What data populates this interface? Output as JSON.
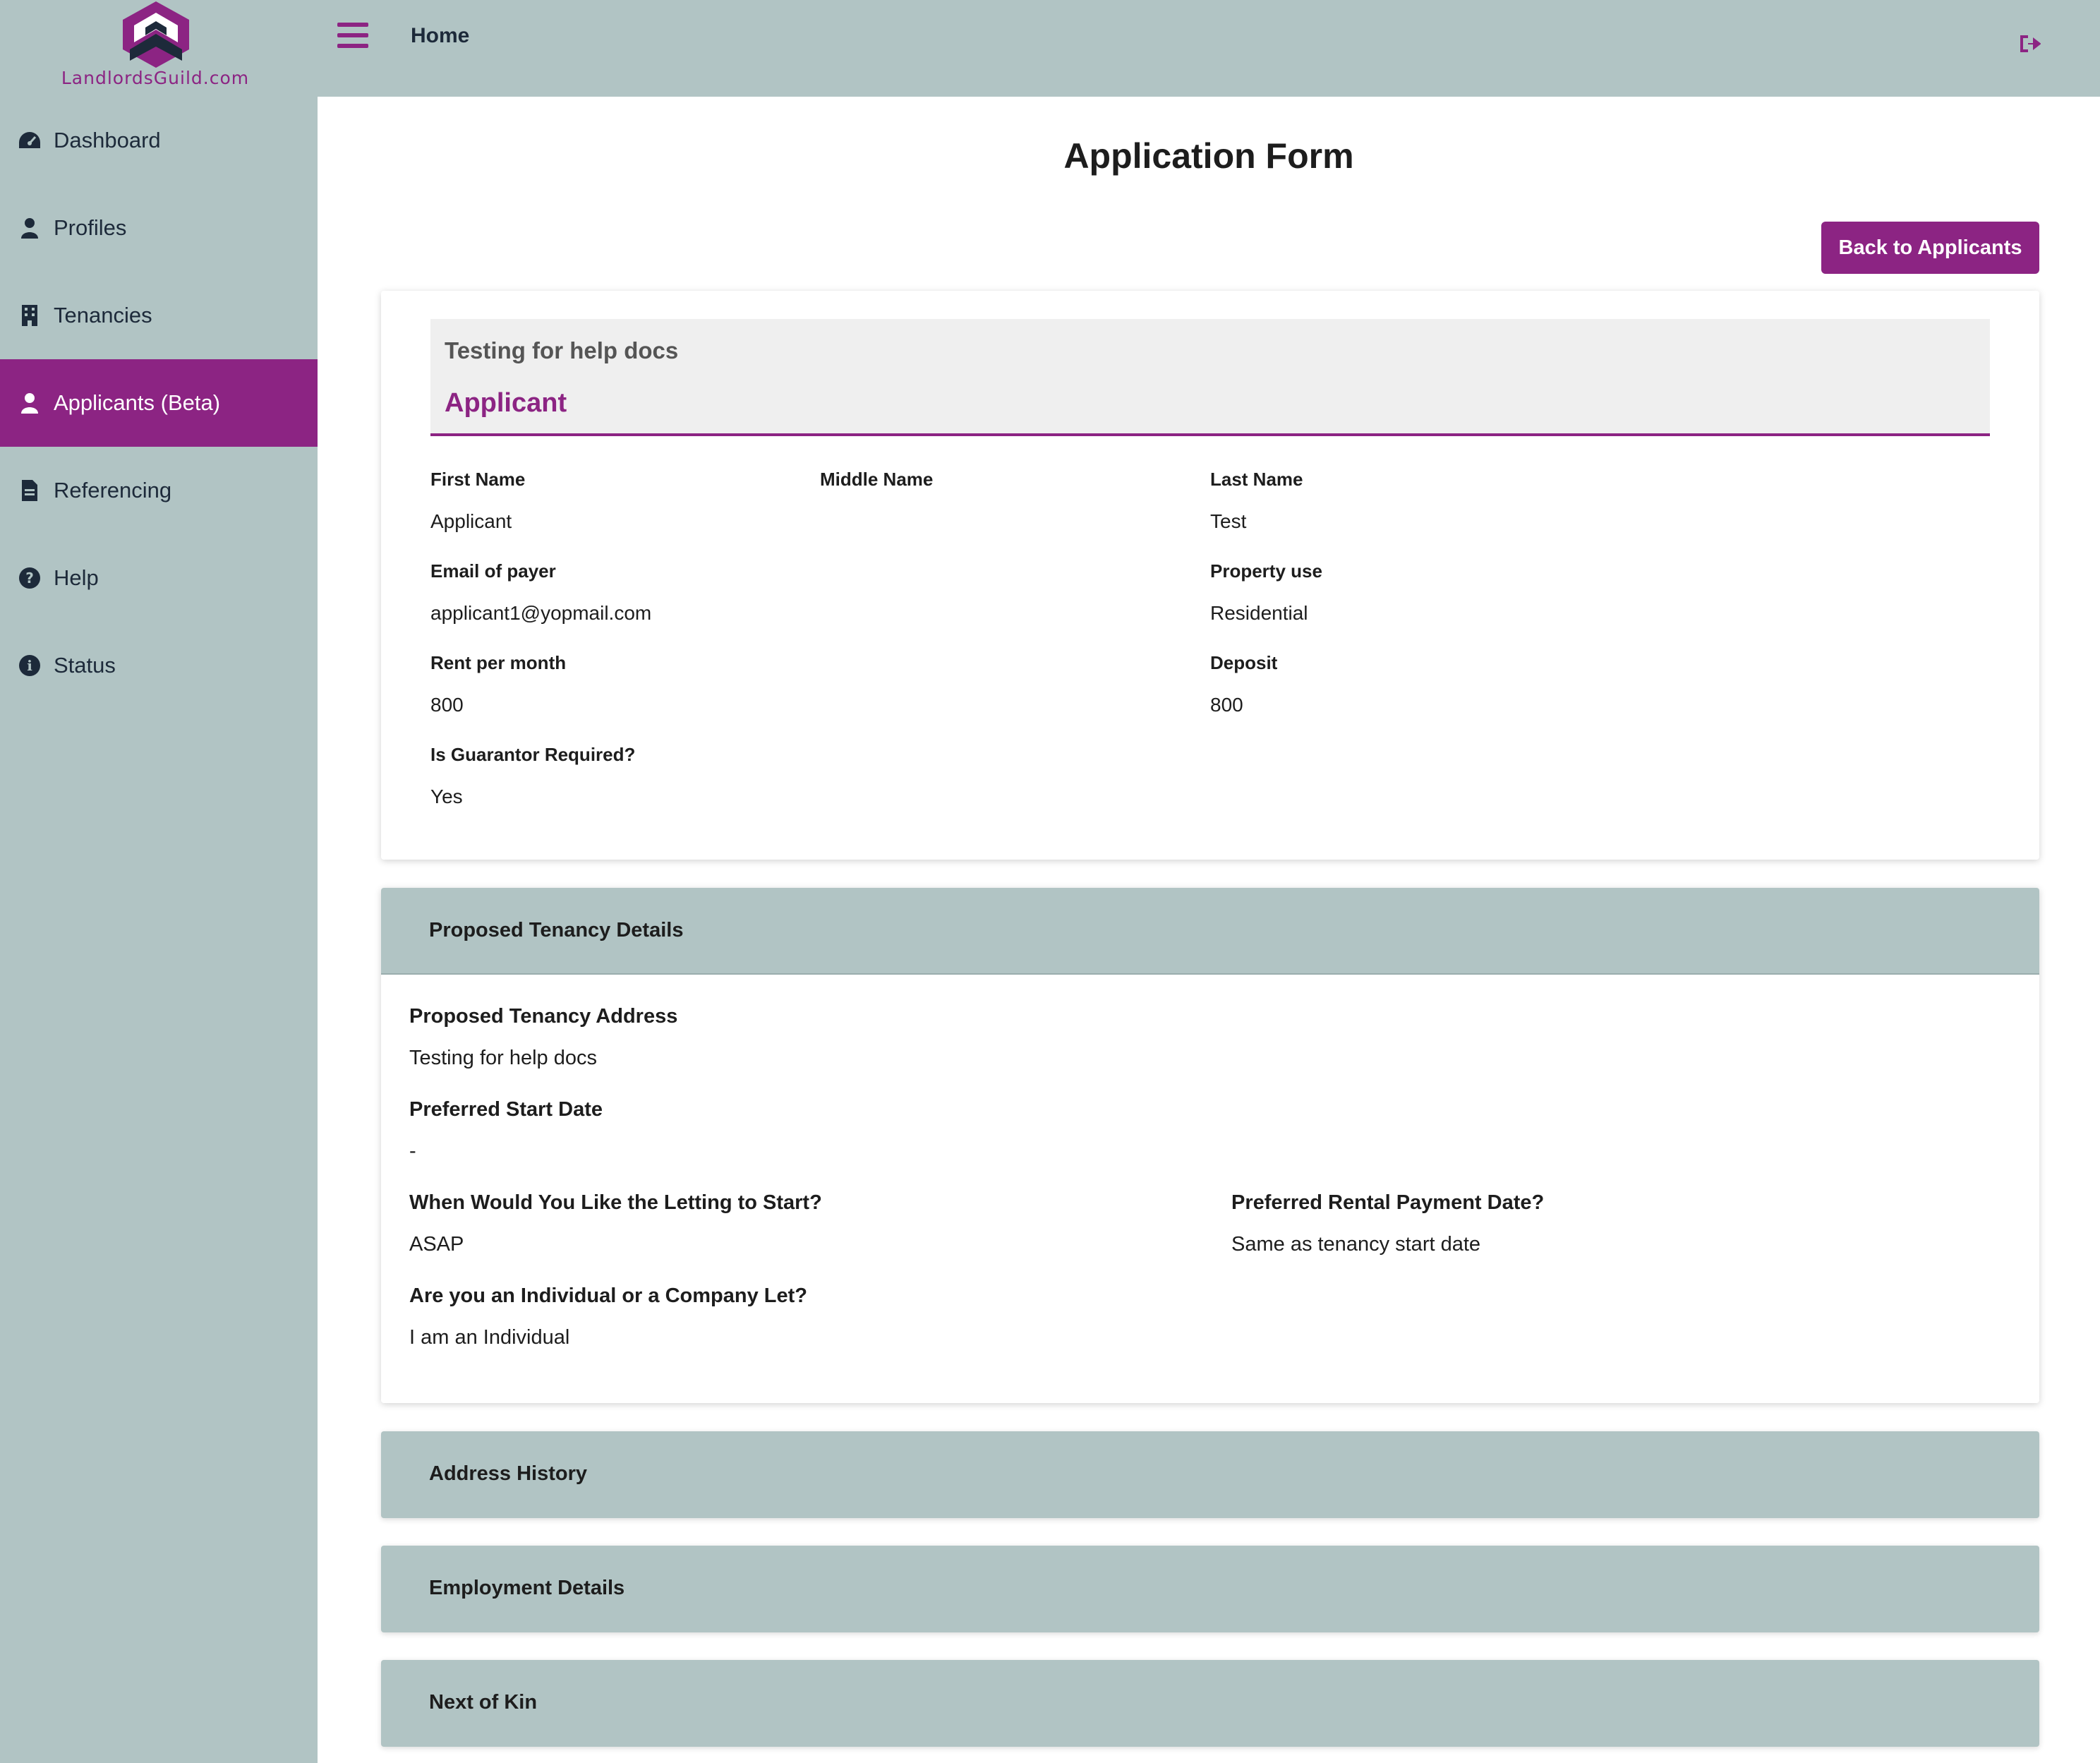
{
  "brand": {
    "name": "LandlordsGuild.com",
    "color": "#8c2483"
  },
  "topbar": {
    "title": "Home",
    "menu_icon": "hamburger-icon",
    "logout_icon": "sign-out-icon"
  },
  "sidebar": {
    "items": [
      {
        "label": "Dashboard",
        "icon": "dashboard-gauge-icon",
        "active": false
      },
      {
        "label": "Profiles",
        "icon": "user-icon",
        "active": false
      },
      {
        "label": "Tenancies",
        "icon": "building-icon",
        "active": false
      },
      {
        "label": "Applicants (Beta)",
        "icon": "user-icon",
        "active": true
      },
      {
        "label": "Referencing",
        "icon": "document-icon",
        "active": false
      },
      {
        "label": "Help",
        "icon": "question-circle-icon",
        "active": false
      },
      {
        "label": "Status",
        "icon": "info-circle-icon",
        "active": false
      }
    ]
  },
  "page": {
    "title": "Application Form",
    "back_button": "Back to Applicants"
  },
  "applicant": {
    "subtitle": "Testing for help docs",
    "heading": "Applicant",
    "first_name_label": "First Name",
    "first_name": "Applicant",
    "middle_name_label": "Middle Name",
    "middle_name": "",
    "last_name_label": "Last Name",
    "last_name": "Test",
    "email_label": "Email of payer",
    "email": "applicant1@yopmail.com",
    "property_use_label": "Property use",
    "property_use": "Residential",
    "rent_label": "Rent per month",
    "rent": "800",
    "deposit_label": "Deposit",
    "deposit": "800",
    "guarantor_label": "Is Guarantor Required?",
    "guarantor": "Yes"
  },
  "tenancy": {
    "heading": "Proposed Tenancy Details",
    "address_label": "Proposed Tenancy Address",
    "address": "Testing for help docs",
    "start_date_label": "Preferred Start Date",
    "start_date": "-",
    "letting_start_label": "When Would You Like the Letting to Start?",
    "letting_start": "ASAP",
    "payment_date_label": "Preferred Rental Payment Date?",
    "payment_date": "Same as tenancy start date",
    "let_type_label": "Are you an Individual or a Company Let?",
    "let_type": "I am an Individual"
  },
  "sections": {
    "address_history": "Address History",
    "employment": "Employment Details",
    "next_of_kin": "Next of Kin"
  }
}
